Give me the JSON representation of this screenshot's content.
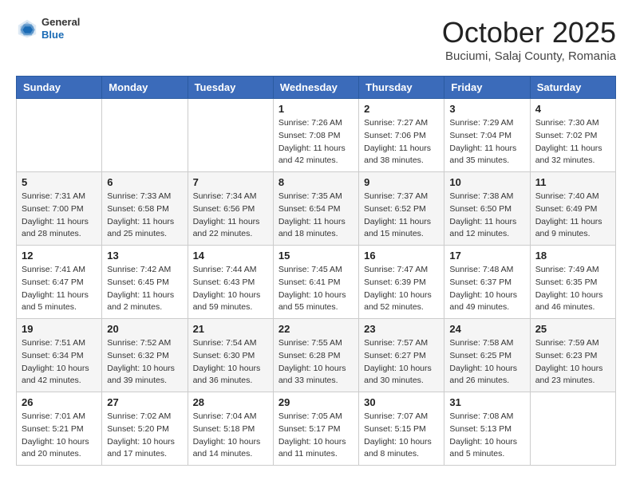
{
  "header": {
    "logo": {
      "general": "General",
      "blue": "Blue"
    },
    "month": "October 2025",
    "location": "Buciumi, Salaj County, Romania"
  },
  "weekdays": [
    "Sunday",
    "Monday",
    "Tuesday",
    "Wednesday",
    "Thursday",
    "Friday",
    "Saturday"
  ],
  "weeks": [
    [
      {
        "day": "",
        "info": ""
      },
      {
        "day": "",
        "info": ""
      },
      {
        "day": "",
        "info": ""
      },
      {
        "day": "1",
        "info": "Sunrise: 7:26 AM\nSunset: 7:08 PM\nDaylight: 11 hours\nand 42 minutes."
      },
      {
        "day": "2",
        "info": "Sunrise: 7:27 AM\nSunset: 7:06 PM\nDaylight: 11 hours\nand 38 minutes."
      },
      {
        "day": "3",
        "info": "Sunrise: 7:29 AM\nSunset: 7:04 PM\nDaylight: 11 hours\nand 35 minutes."
      },
      {
        "day": "4",
        "info": "Sunrise: 7:30 AM\nSunset: 7:02 PM\nDaylight: 11 hours\nand 32 minutes."
      }
    ],
    [
      {
        "day": "5",
        "info": "Sunrise: 7:31 AM\nSunset: 7:00 PM\nDaylight: 11 hours\nand 28 minutes."
      },
      {
        "day": "6",
        "info": "Sunrise: 7:33 AM\nSunset: 6:58 PM\nDaylight: 11 hours\nand 25 minutes."
      },
      {
        "day": "7",
        "info": "Sunrise: 7:34 AM\nSunset: 6:56 PM\nDaylight: 11 hours\nand 22 minutes."
      },
      {
        "day": "8",
        "info": "Sunrise: 7:35 AM\nSunset: 6:54 PM\nDaylight: 11 hours\nand 18 minutes."
      },
      {
        "day": "9",
        "info": "Sunrise: 7:37 AM\nSunset: 6:52 PM\nDaylight: 11 hours\nand 15 minutes."
      },
      {
        "day": "10",
        "info": "Sunrise: 7:38 AM\nSunset: 6:50 PM\nDaylight: 11 hours\nand 12 minutes."
      },
      {
        "day": "11",
        "info": "Sunrise: 7:40 AM\nSunset: 6:49 PM\nDaylight: 11 hours\nand 9 minutes."
      }
    ],
    [
      {
        "day": "12",
        "info": "Sunrise: 7:41 AM\nSunset: 6:47 PM\nDaylight: 11 hours\nand 5 minutes."
      },
      {
        "day": "13",
        "info": "Sunrise: 7:42 AM\nSunset: 6:45 PM\nDaylight: 11 hours\nand 2 minutes."
      },
      {
        "day": "14",
        "info": "Sunrise: 7:44 AM\nSunset: 6:43 PM\nDaylight: 10 hours\nand 59 minutes."
      },
      {
        "day": "15",
        "info": "Sunrise: 7:45 AM\nSunset: 6:41 PM\nDaylight: 10 hours\nand 55 minutes."
      },
      {
        "day": "16",
        "info": "Sunrise: 7:47 AM\nSunset: 6:39 PM\nDaylight: 10 hours\nand 52 minutes."
      },
      {
        "day": "17",
        "info": "Sunrise: 7:48 AM\nSunset: 6:37 PM\nDaylight: 10 hours\nand 49 minutes."
      },
      {
        "day": "18",
        "info": "Sunrise: 7:49 AM\nSunset: 6:35 PM\nDaylight: 10 hours\nand 46 minutes."
      }
    ],
    [
      {
        "day": "19",
        "info": "Sunrise: 7:51 AM\nSunset: 6:34 PM\nDaylight: 10 hours\nand 42 minutes."
      },
      {
        "day": "20",
        "info": "Sunrise: 7:52 AM\nSunset: 6:32 PM\nDaylight: 10 hours\nand 39 minutes."
      },
      {
        "day": "21",
        "info": "Sunrise: 7:54 AM\nSunset: 6:30 PM\nDaylight: 10 hours\nand 36 minutes."
      },
      {
        "day": "22",
        "info": "Sunrise: 7:55 AM\nSunset: 6:28 PM\nDaylight: 10 hours\nand 33 minutes."
      },
      {
        "day": "23",
        "info": "Sunrise: 7:57 AM\nSunset: 6:27 PM\nDaylight: 10 hours\nand 30 minutes."
      },
      {
        "day": "24",
        "info": "Sunrise: 7:58 AM\nSunset: 6:25 PM\nDaylight: 10 hours\nand 26 minutes."
      },
      {
        "day": "25",
        "info": "Sunrise: 7:59 AM\nSunset: 6:23 PM\nDaylight: 10 hours\nand 23 minutes."
      }
    ],
    [
      {
        "day": "26",
        "info": "Sunrise: 7:01 AM\nSunset: 5:21 PM\nDaylight: 10 hours\nand 20 minutes."
      },
      {
        "day": "27",
        "info": "Sunrise: 7:02 AM\nSunset: 5:20 PM\nDaylight: 10 hours\nand 17 minutes."
      },
      {
        "day": "28",
        "info": "Sunrise: 7:04 AM\nSunset: 5:18 PM\nDaylight: 10 hours\nand 14 minutes."
      },
      {
        "day": "29",
        "info": "Sunrise: 7:05 AM\nSunset: 5:17 PM\nDaylight: 10 hours\nand 11 minutes."
      },
      {
        "day": "30",
        "info": "Sunrise: 7:07 AM\nSunset: 5:15 PM\nDaylight: 10 hours\nand 8 minutes."
      },
      {
        "day": "31",
        "info": "Sunrise: 7:08 AM\nSunset: 5:13 PM\nDaylight: 10 hours\nand 5 minutes."
      },
      {
        "day": "",
        "info": ""
      }
    ]
  ]
}
